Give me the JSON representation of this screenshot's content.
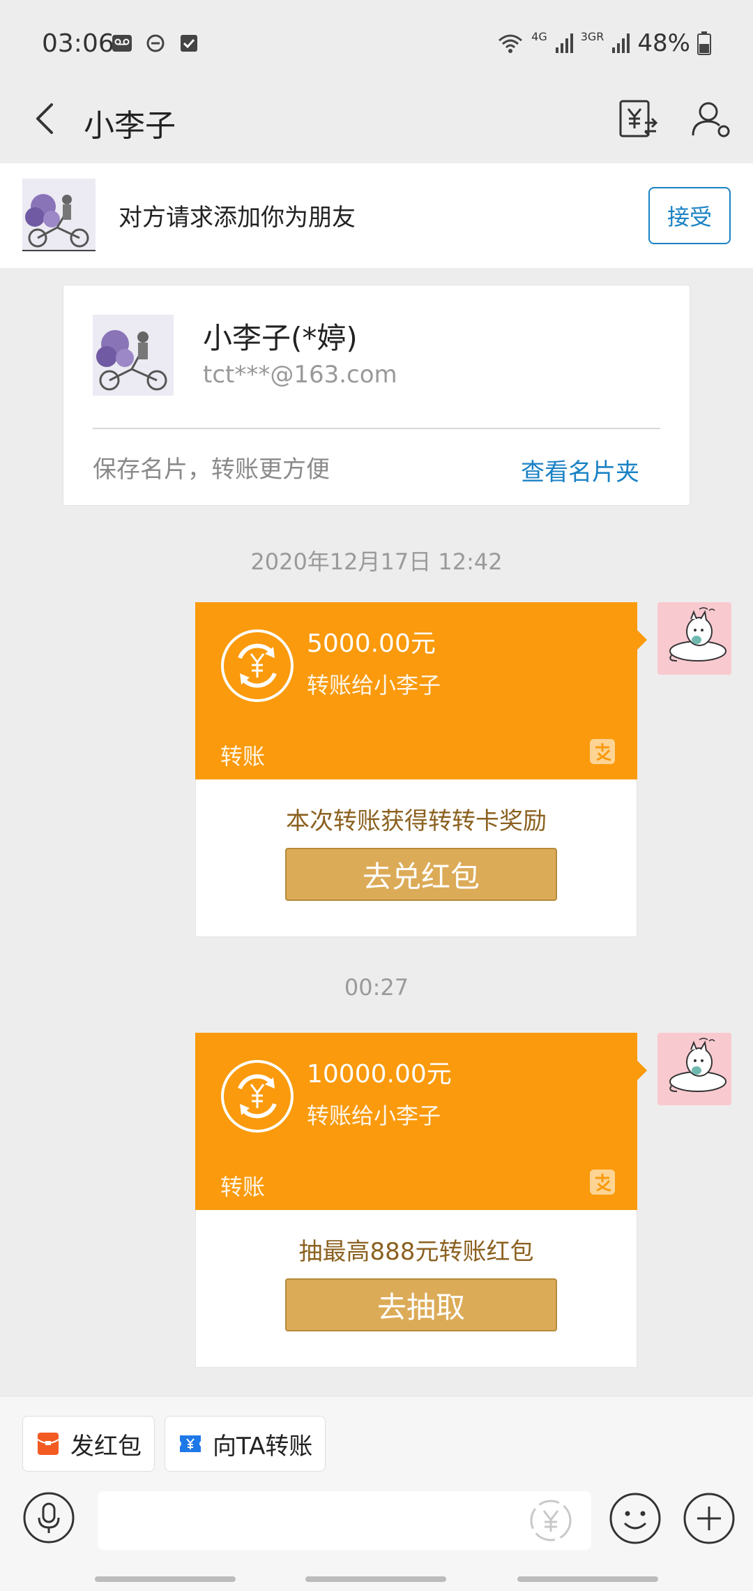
{
  "status_bar": {
    "time": "03:06",
    "network_4g": "4G",
    "network_3g": "3GR",
    "battery": "48%"
  },
  "header": {
    "title": "小李子"
  },
  "friend_request": {
    "text": "对方请求添加你为朋友",
    "accept_label": "接受"
  },
  "contact_card": {
    "name": "小李子(*婷)",
    "email": "tct***@163.com",
    "save_text": "保存名片，转账更方便",
    "view_link": "查看名片夹"
  },
  "messages": [
    {
      "timestamp": "2020年12月17日 12:42",
      "amount": "5000.00元",
      "description": "转账给小李子",
      "label": "转账",
      "reward_text": "本次转账获得转转卡奖励",
      "button_label": "去兑红包"
    },
    {
      "timestamp": "00:27",
      "amount": "10000.00元",
      "description": "转账给小李子",
      "label": "转账",
      "reward_text": "抽最高888元转账红包",
      "button_label": "去抽取"
    }
  ],
  "bottom_bar": {
    "red_packet_label": "发红包",
    "transfer_label": "向TA转账",
    "input_placeholder": ""
  },
  "colors": {
    "accent_blue": "#1a82c4",
    "transfer_orange": "#fa9a0c",
    "reward_button": "#dcab58",
    "reward_text": "#8b6120"
  }
}
